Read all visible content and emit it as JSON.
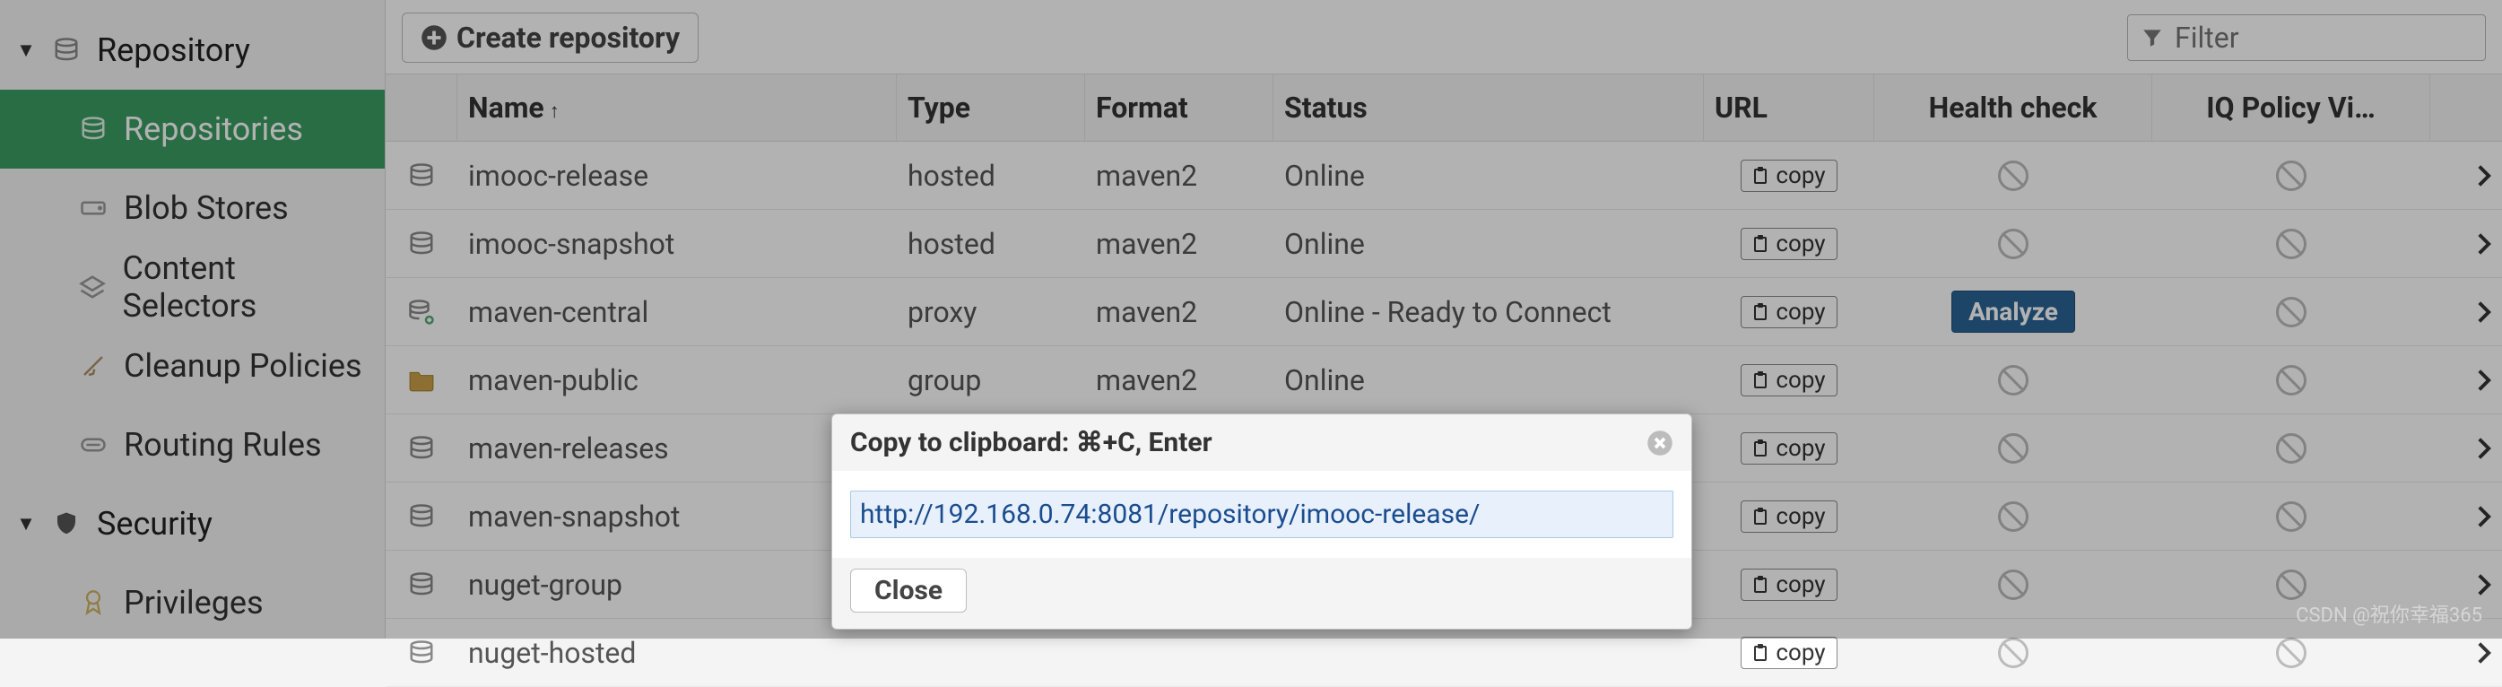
{
  "sidebar": {
    "repository": {
      "label": "Repository",
      "children": {
        "repositories": "Repositories",
        "blob_stores": "Blob Stores",
        "content_selectors": "Content Selectors",
        "cleanup_policies": "Cleanup Policies",
        "routing_rules": "Routing Rules"
      }
    },
    "security": {
      "label": "Security",
      "children": {
        "privileges": "Privileges"
      }
    }
  },
  "toolbar": {
    "create_label": "Create repository",
    "filter_placeholder": "Filter"
  },
  "columns": {
    "name": "Name",
    "type": "Type",
    "format": "Format",
    "status": "Status",
    "url": "URL",
    "health": "Health check",
    "iq": "IQ Policy Vi…"
  },
  "buttons": {
    "copy": "copy",
    "analyze": "Analyze",
    "close": "Close"
  },
  "rows": [
    {
      "icon": "hosted",
      "name": "imooc-release",
      "type": "hosted",
      "format": "maven2",
      "status": "Online",
      "health": "none",
      "iq": "none"
    },
    {
      "icon": "hosted",
      "name": "imooc-snapshot",
      "type": "hosted",
      "format": "maven2",
      "status": "Online",
      "health": "none",
      "iq": "none"
    },
    {
      "icon": "proxy",
      "name": "maven-central",
      "type": "proxy",
      "format": "maven2",
      "status": "Online - Ready to Connect",
      "health": "analyze",
      "iq": "none"
    },
    {
      "icon": "group",
      "name": "maven-public",
      "type": "group",
      "format": "maven2",
      "status": "Online",
      "health": "none",
      "iq": "none"
    },
    {
      "icon": "hosted",
      "name": "maven-releases",
      "type": "",
      "format": "",
      "status": "",
      "health": "none",
      "iq": "none"
    },
    {
      "icon": "hosted",
      "name": "maven-snapshot",
      "type": "",
      "format": "",
      "status": "",
      "health": "none",
      "iq": "none"
    },
    {
      "icon": "hosted",
      "name": "nuget-group",
      "type": "",
      "format": "",
      "status": "",
      "health": "none",
      "iq": "none"
    },
    {
      "icon": "hosted",
      "name": "nuget-hosted",
      "type": "",
      "format": "",
      "status": "",
      "health": "none",
      "iq": "none"
    }
  ],
  "modal": {
    "title": "Copy to clipboard: ⌘+C, Enter",
    "url": "http://192.168.0.74:8081/repository/imooc-release/"
  },
  "watermark": "CSDN @祝你幸福365"
}
